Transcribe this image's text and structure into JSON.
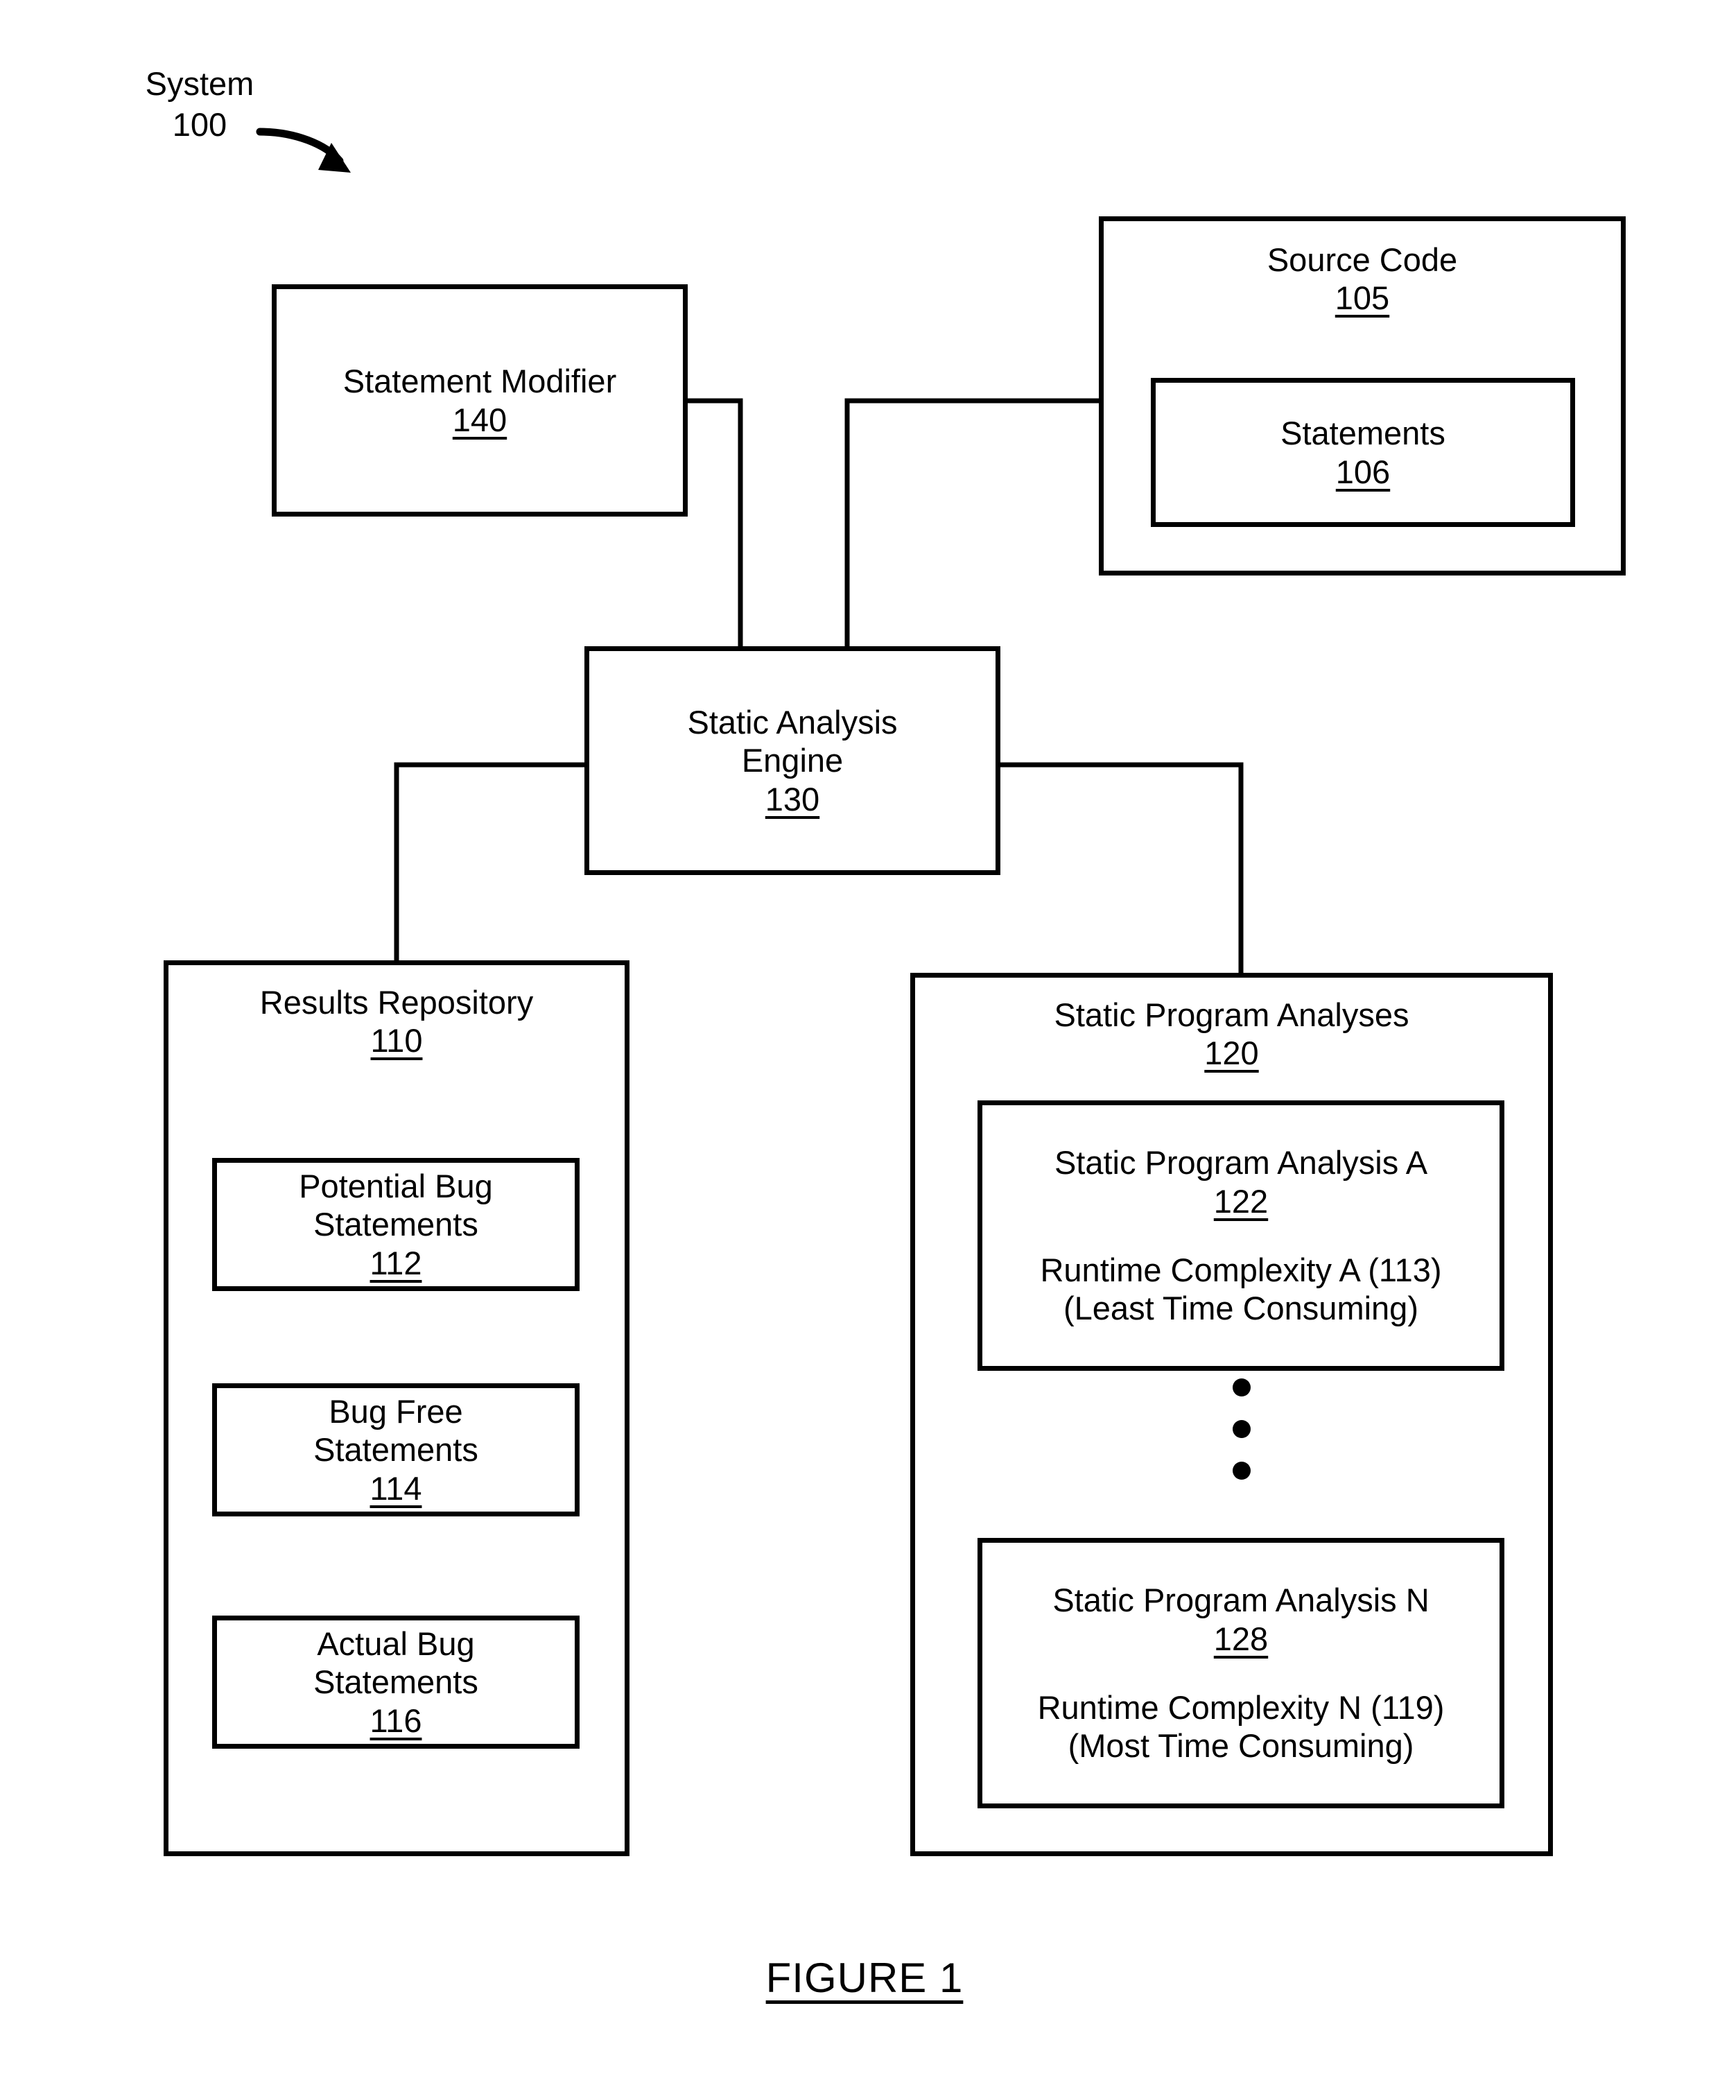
{
  "figure": {
    "system_label": "System\n100",
    "caption": "FIGURE 1"
  },
  "nodes": {
    "statement_modifier": {
      "title": "Statement Modifier",
      "ref": "140"
    },
    "source_code": {
      "title": "Source Code",
      "ref": "105"
    },
    "statements": {
      "title": "Statements",
      "ref": "106"
    },
    "static_analysis_engine": {
      "title": "Static Analysis\nEngine",
      "ref": "130"
    },
    "results_repository": {
      "title": "Results Repository",
      "ref": "110"
    },
    "potential_bug_statements": {
      "title": "Potential Bug\nStatements",
      "ref": "112"
    },
    "bug_free_statements": {
      "title": "Bug Free\nStatements",
      "ref": "114"
    },
    "actual_bug_statements": {
      "title": "Actual Bug\nStatements",
      "ref": "116"
    },
    "static_program_analyses": {
      "title": "Static Program Analyses",
      "ref": "120"
    },
    "static_program_analysis_a": {
      "title": "Static Program Analysis A",
      "ref": "122",
      "detail": "Runtime Complexity A (113)\n(Least Time Consuming)"
    },
    "static_program_analysis_n": {
      "title": "Static Program Analysis N",
      "ref": "128",
      "detail": "Runtime Complexity N (119)\n(Most Time Consuming)"
    }
  },
  "ellipsis": {
    "dot_count": 3
  },
  "style": {
    "line_color": "#000000",
    "background": "#ffffff"
  }
}
